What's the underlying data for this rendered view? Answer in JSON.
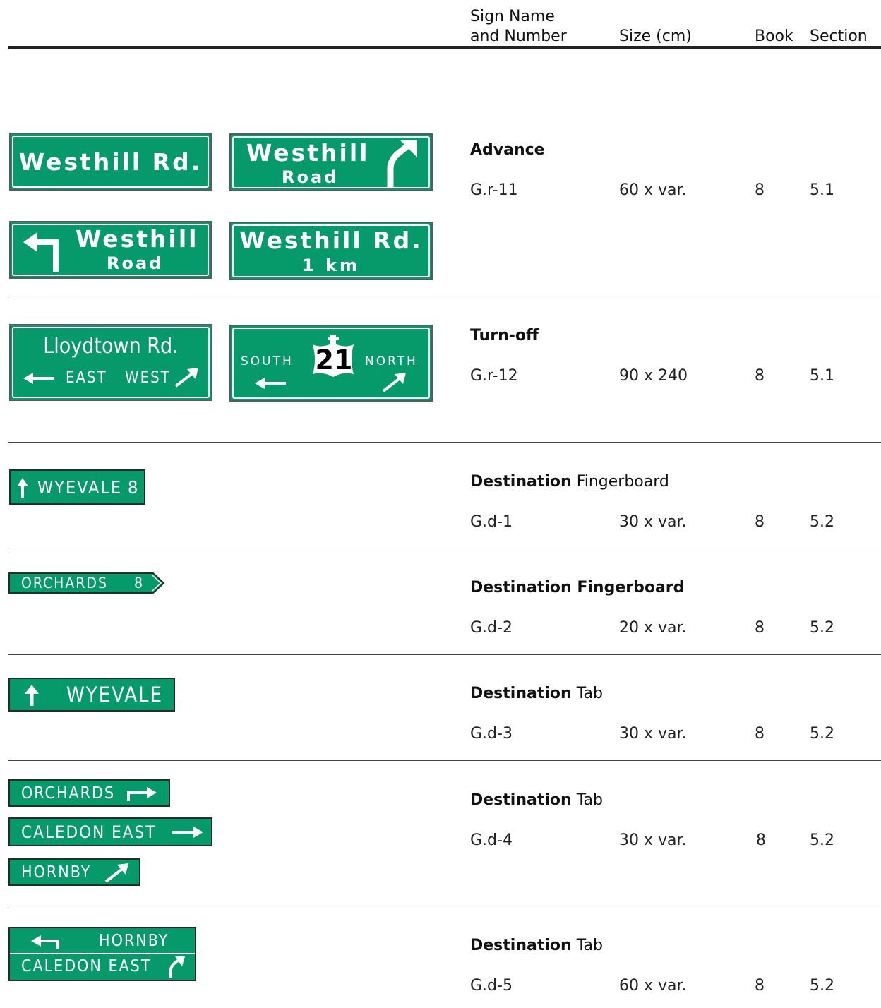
{
  "header": {
    "col_name": [
      "Sign Name",
      "and Number"
    ],
    "col_size": "Size (cm)",
    "col_book": "Book",
    "col_section": "Section"
  },
  "rows": [
    {
      "title_bold": "Advance",
      "title_rest": "",
      "code": "G.r-11",
      "size": "60 x var.",
      "book": "8",
      "section": "5.1",
      "signs": [
        {
          "lines": [
            "Westhill Rd."
          ]
        },
        {
          "lines": [
            "Westhill",
            "Road"
          ],
          "arrow": "curve-right-up"
        },
        {
          "lines": [
            "Westhill",
            "Road"
          ],
          "arrow": "turn-left"
        },
        {
          "lines": [
            "Westhill Rd.",
            "1 km"
          ]
        }
      ]
    },
    {
      "title_bold": "Turn-off",
      "title_rest": "",
      "code": "G.r-12",
      "size": "90 x 240",
      "book": "8",
      "section": "5.1",
      "signs": [
        {
          "lines": [
            "Lloydtown Rd.",
            "EAST",
            "WEST"
          ],
          "arrows": [
            "arrow-left",
            "arrow-up-right"
          ]
        },
        {
          "lines": [
            "SOUTH",
            "21",
            "NORTH"
          ],
          "shield": "crown-shield",
          "arrows": [
            "arrow-left",
            "arrow-up-right"
          ]
        }
      ]
    },
    {
      "title_bold": "Destination",
      "title_rest": "Fingerboard",
      "code": "G.d-1",
      "size": "30 x var.",
      "book": "8",
      "section": "5.2",
      "signs": [
        {
          "lines": [
            "WYEVALE",
            "8"
          ],
          "arrow": "arrow-up"
        }
      ]
    },
    {
      "title_bold": "Destination Fingerboard",
      "title_rest": "",
      "code": "G.d-2",
      "size": "20 x var.",
      "book": "8",
      "section": "5.2",
      "signs": [
        {
          "lines": [
            "ORCHARDS",
            "8"
          ],
          "shape": "pointed-right"
        }
      ]
    },
    {
      "title_bold": "Destination",
      "title_rest": "Tab",
      "code": "G.d-3",
      "size": "30 x var.",
      "book": "8",
      "section": "5.2",
      "signs": [
        {
          "lines": [
            "WYEVALE"
          ],
          "arrow": "arrow-up"
        }
      ]
    },
    {
      "title_bold": "Destination",
      "title_rest": "Tab",
      "code": "G.d-4",
      "size": "30 x var.",
      "book": "8",
      "section": "5.2",
      "signs": [
        {
          "lines": [
            "ORCHARDS"
          ],
          "arrow": "turn-right"
        },
        {
          "lines": [
            "CALEDON EAST"
          ],
          "arrow": "arrow-right"
        },
        {
          "lines": [
            "HORNBY"
          ],
          "arrow": "arrow-up-right"
        }
      ]
    },
    {
      "title_bold": "Destination",
      "title_rest": "Tab",
      "code": "G.d-5",
      "size": "60 x var.",
      "book": "8",
      "section": "5.2",
      "signs": [
        {
          "lines": [
            "HORNBY"
          ],
          "arrow": "turn-left"
        },
        {
          "lines": [
            "CALEDON EAST"
          ],
          "arrow": "curve-right-up"
        }
      ]
    }
  ],
  "colors": {
    "sign_green": "#069a6a",
    "sign_text": "#ffffff",
    "rule": "#444444"
  }
}
